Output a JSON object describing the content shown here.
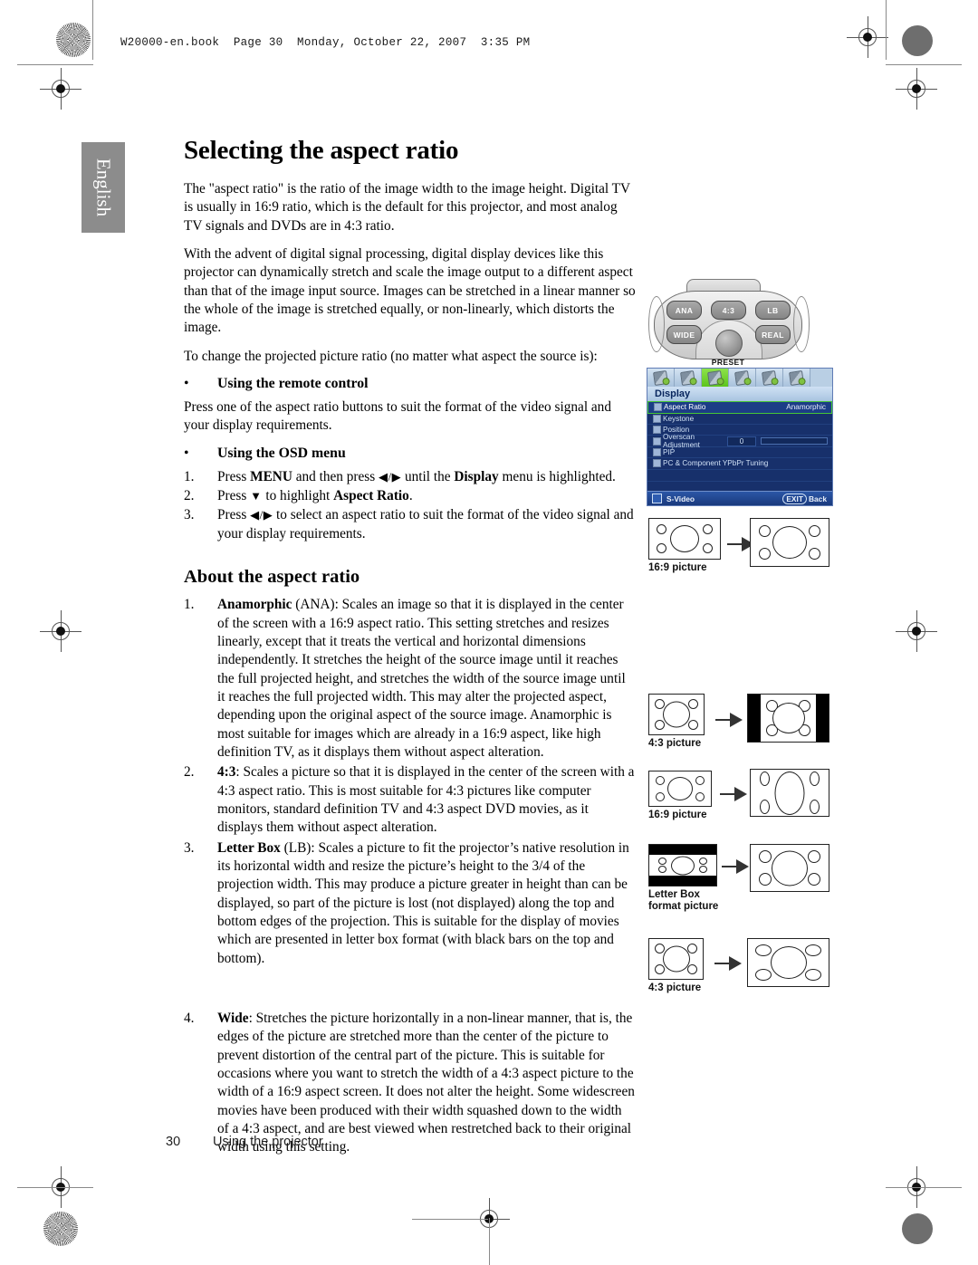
{
  "header": {
    "running_head": "W20000-en.book  Page 30  Monday, October 22, 2007  3:35 PM"
  },
  "sidebar": {
    "language_tab": "English"
  },
  "page": {
    "title": "Selecting the aspect ratio",
    "paragraphs": [
      "The \"aspect ratio\" is the ratio of the image width to the image height. Digital TV is usually in 16:9 ratio, which is the default for this projector, and most analog TV signals and DVDs are in 4:3 ratio.",
      "With the advent of digital signal processing, digital display devices like this projector can dynamically stretch and scale the image output to a different aspect than that of the image input source. Images can be stretched in a linear manner so the whole of the image is stretched equally, or non-linearly, which distorts the image.",
      "To change the projected picture ratio (no matter what aspect the source is):"
    ],
    "remote_section": {
      "bullet": "•",
      "heading": "Using the remote control",
      "text": "Press one of the aspect ratio buttons to suit the format of the video signal and your display requirements."
    },
    "osd_section": {
      "bullet": "•",
      "heading": "Using the OSD menu",
      "steps": [
        {
          "num": "1.",
          "pre": "Press ",
          "b1": "MENU",
          "mid": " and then press ",
          "glyph": "◀/▶",
          "post": " until the ",
          "b2": "Display",
          "tail": " menu is highlighted."
        },
        {
          "num": "2.",
          "pre": "Press ",
          "glyph": "▼",
          "post": " to highlight ",
          "b2": "Aspect Ratio",
          "tail": "."
        },
        {
          "num": "3.",
          "pre": "Press ",
          "glyph": "◀/▶",
          "post": " to select an aspect ratio to suit the format of the video signal and your display requirements."
        }
      ]
    },
    "about_heading": "About the aspect ratio",
    "about_items": [
      {
        "num": "1.",
        "term": "Anamorphic (ANA)",
        "term_bold": "Anamorphic",
        "term_rest": " (ANA)",
        "text": ": Scales an image so that it is displayed in the center of the screen with a 16:9 aspect ratio. This setting stretches and resizes linearly, except that it treats the vertical and horizontal dimensions independently. It stretches the height of the source image until it reaches the full projected height, and stretches the width of the source image until it reaches the full projected width. This may alter the projected aspect, depending upon the original aspect of the source image. Anamorphic is most suitable for images which are already in a 16:9 aspect, like high definition TV, as it displays them without aspect alteration."
      },
      {
        "num": "2.",
        "term_bold": "4:3",
        "term_rest": "",
        "text": ": Scales a picture so that it is displayed in the center of the screen with a 4:3 aspect ratio. This is most suitable for 4:3 pictures like computer monitors, standard definition TV and 4:3 aspect DVD movies, as it displays them without aspect alteration."
      },
      {
        "num": "3.",
        "term_bold": "Letter Box",
        "term_rest": " (LB)",
        "text": ": Scales a picture to fit the projector’s native resolution in its horizontal width and resize the picture’s height to the 3/4 of the projection width. This may produce a picture greater in height than can be displayed, so part of the picture is lost (not displayed) along the top and bottom edges of the projection. This is suitable for the display of movies which are presented in letter box format (with black bars on the top and bottom)."
      },
      {
        "num": "4.",
        "term_bold": "Wide",
        "term_rest": "",
        "text": ": Stretches the picture horizontally in a non-linear manner, that is, the edges of the picture are stretched more than the center of the picture to prevent distortion of the central part of the picture. This is suitable for occasions where you want to stretch the width of a 4:3 aspect picture to the width of a 16:9 aspect screen. It does not alter the height. Some widescreen movies have been produced with their width squashed down to the width of a 4:3 aspect, and are best viewed when restretched back to their original width using this setting."
      }
    ],
    "footer": {
      "page_number": "30",
      "section": "Using the projector"
    }
  },
  "remote": {
    "buttons": [
      "ANA",
      "4:3",
      "LB",
      "WIDE",
      "REAL"
    ],
    "button_ana": "ANA",
    "button_43": "4:3",
    "button_lb": "LB",
    "button_wide": "WIDE",
    "button_real": "REAL",
    "preset_label": "PRESET"
  },
  "osd": {
    "menu_title": "Display",
    "tab_count": 6,
    "active_tab_index": 2,
    "rows": [
      {
        "label": "Aspect Ratio",
        "value": "Anamorphic",
        "selected": true
      },
      {
        "label": "Keystone",
        "value": "",
        "selected": false
      },
      {
        "label": "Position",
        "value": "",
        "selected": false
      },
      {
        "label": "Overscan Adjustment",
        "value": "0",
        "selected": false,
        "has_slider": true
      },
      {
        "label": "PIP",
        "value": "",
        "selected": false
      },
      {
        "label": "PC & Component YPbPr Tuning",
        "value": "",
        "selected": false
      }
    ],
    "footer_source": "S-Video",
    "footer_exit": "EXIT",
    "footer_back": "Back",
    "highlight_color": "#46c636",
    "background_color": "#17306b"
  },
  "diagrams": [
    {
      "id": "anamorphic",
      "caption": "16:9 picture",
      "source": "16:9",
      "result": "16:9 enlarged"
    },
    {
      "id": "four-three",
      "caption": "4:3 picture",
      "source": "4:3",
      "result": "4:3 pillarboxed"
    },
    {
      "id": "letterbox-src",
      "caption": "16:9 picture",
      "source": "16:9",
      "result": "stretched vertically"
    },
    {
      "id": "letterbox",
      "caption": "Letter Box\nformat picture",
      "source": "letterbox",
      "result": "16:9 full"
    },
    {
      "id": "wide",
      "caption": "4:3 picture",
      "source": "4:3",
      "result": "16:9 non-linear stretch"
    }
  ]
}
